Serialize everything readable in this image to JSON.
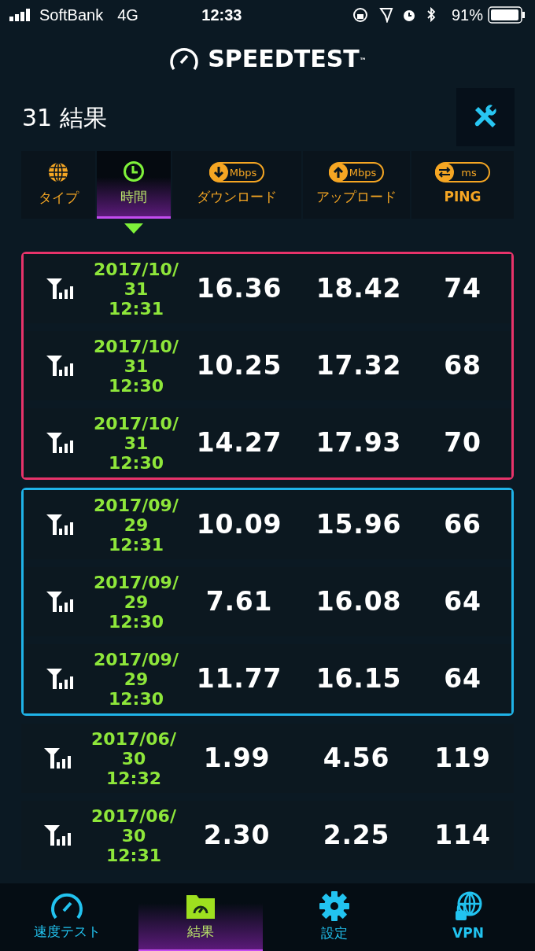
{
  "status_bar": {
    "carrier": "SoftBank",
    "network": "4G",
    "time": "12:33",
    "battery": "91%"
  },
  "logo": {
    "text": "SPEEDTEST",
    "mark": "™"
  },
  "title": "31 結果",
  "columns": [
    {
      "kind": "type",
      "label": "タイプ",
      "selected": false
    },
    {
      "kind": "time",
      "label": "時間",
      "selected": true
    },
    {
      "kind": "download",
      "label": "ダウンロード",
      "unit": "Mbps",
      "selected": false
    },
    {
      "kind": "upload",
      "label": "アップロード",
      "unit": "Mbps",
      "selected": false
    },
    {
      "kind": "ping",
      "label": "PING",
      "unit": "ms",
      "selected": false
    }
  ],
  "groups": [
    {
      "color": "#e8336a",
      "rows": [
        {
          "date_line_1": "2017/10/",
          "date_line_2": "31",
          "time": "12:31",
          "download": "16.36",
          "upload": "18.42",
          "ping": "74"
        },
        {
          "date_line_1": "2017/10/",
          "date_line_2": "31",
          "time": "12:30",
          "download": "10.25",
          "upload": "17.32",
          "ping": "68"
        },
        {
          "date_line_1": "2017/10/",
          "date_line_2": "31",
          "time": "12:30",
          "download": "14.27",
          "upload": "17.93",
          "ping": "70"
        }
      ]
    },
    {
      "color": "#1fb3e8",
      "rows": [
        {
          "date_line_1": "2017/09/",
          "date_line_2": "29",
          "time": "12:31",
          "download": "10.09",
          "upload": "15.96",
          "ping": "66"
        },
        {
          "date_line_1": "2017/09/",
          "date_line_2": "29",
          "time": "12:30",
          "download": "7.61",
          "upload": "16.08",
          "ping": "64"
        },
        {
          "date_line_1": "2017/09/",
          "date_line_2": "29",
          "time": "12:30",
          "download": "11.77",
          "upload": "16.15",
          "ping": "64"
        }
      ]
    },
    {
      "rows": [
        {
          "date_line_1": "2017/06/",
          "date_line_2": "30",
          "time": "12:32",
          "download": "1.99",
          "upload": "4.56",
          "ping": "119"
        },
        {
          "date_line_1": "2017/06/",
          "date_line_2": "30",
          "time": "12:31",
          "download": "2.30",
          "upload": "2.25",
          "ping": "114"
        }
      ]
    }
  ],
  "nav": [
    {
      "kind": "speed",
      "label": "速度テスト",
      "selected": false
    },
    {
      "kind": "results",
      "label": "結果",
      "selected": true
    },
    {
      "kind": "settings",
      "label": "設定",
      "selected": false
    },
    {
      "kind": "vpn",
      "label": "VPN",
      "selected": false
    }
  ]
}
